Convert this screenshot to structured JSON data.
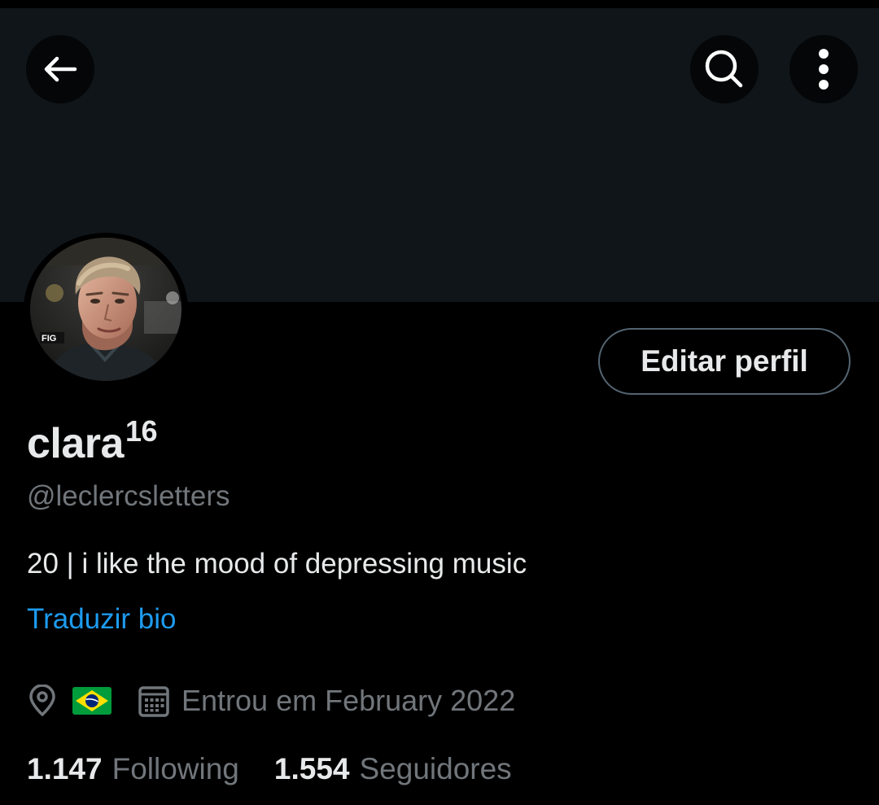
{
  "profile": {
    "display_name": "clara",
    "display_name_sup": "16",
    "handle": "@leclercsletters",
    "bio": "20 | i like the mood of depressing music",
    "translate_bio": "Traduzir bio",
    "joined": "Entrou em February 2022",
    "edit_button": "Editar perfil",
    "avatar_badge_text": "FIG"
  },
  "stats": {
    "following_count": "1.147",
    "following_label": "Following",
    "followers_count": "1.554",
    "followers_label": "Seguidores"
  },
  "icons": {
    "back": "arrow-left-icon",
    "search": "search-icon",
    "more": "more-vertical-icon",
    "location": "location-pin-icon",
    "flag": "brazil-flag-icon",
    "calendar": "calendar-icon"
  },
  "colors": {
    "background": "#000000",
    "banner": "#0f1519",
    "text_primary": "#e7e9ea",
    "text_secondary": "#71767b",
    "link": "#1d9bf0",
    "button_border": "#536471"
  }
}
